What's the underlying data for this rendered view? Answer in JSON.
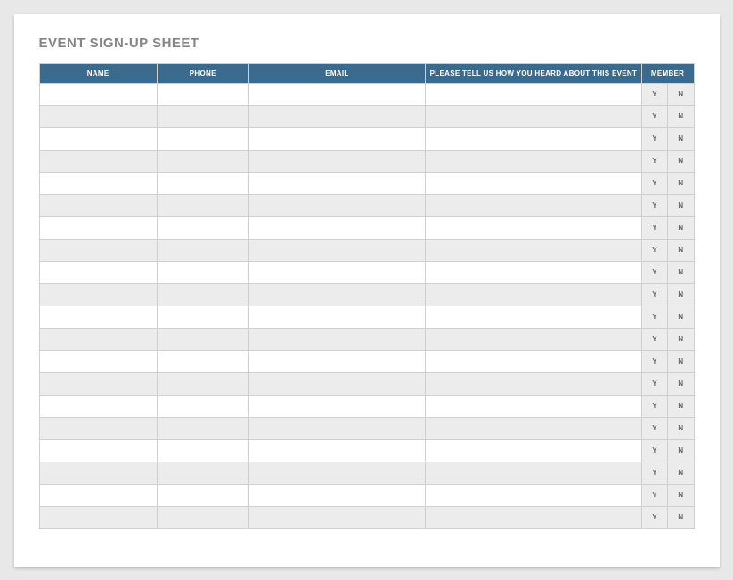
{
  "title": "EVENT SIGN-UP SHEET",
  "headers": {
    "name": "NAME",
    "phone": "PHONE",
    "email": "EMAIL",
    "heard": "PLEASE TELL US HOW YOU HEARD ABOUT THIS EVENT",
    "member": "MEMBER"
  },
  "yn": {
    "y": "Y",
    "n": "N"
  },
  "rows": [
    {
      "name": "",
      "phone": "",
      "email": "",
      "heard": ""
    },
    {
      "name": "",
      "phone": "",
      "email": "",
      "heard": ""
    },
    {
      "name": "",
      "phone": "",
      "email": "",
      "heard": ""
    },
    {
      "name": "",
      "phone": "",
      "email": "",
      "heard": ""
    },
    {
      "name": "",
      "phone": "",
      "email": "",
      "heard": ""
    },
    {
      "name": "",
      "phone": "",
      "email": "",
      "heard": ""
    },
    {
      "name": "",
      "phone": "",
      "email": "",
      "heard": ""
    },
    {
      "name": "",
      "phone": "",
      "email": "",
      "heard": ""
    },
    {
      "name": "",
      "phone": "",
      "email": "",
      "heard": ""
    },
    {
      "name": "",
      "phone": "",
      "email": "",
      "heard": ""
    },
    {
      "name": "",
      "phone": "",
      "email": "",
      "heard": ""
    },
    {
      "name": "",
      "phone": "",
      "email": "",
      "heard": ""
    },
    {
      "name": "",
      "phone": "",
      "email": "",
      "heard": ""
    },
    {
      "name": "",
      "phone": "",
      "email": "",
      "heard": ""
    },
    {
      "name": "",
      "phone": "",
      "email": "",
      "heard": ""
    },
    {
      "name": "",
      "phone": "",
      "email": "",
      "heard": ""
    },
    {
      "name": "",
      "phone": "",
      "email": "",
      "heard": ""
    },
    {
      "name": "",
      "phone": "",
      "email": "",
      "heard": ""
    },
    {
      "name": "",
      "phone": "",
      "email": "",
      "heard": ""
    },
    {
      "name": "",
      "phone": "",
      "email": "",
      "heard": ""
    }
  ]
}
